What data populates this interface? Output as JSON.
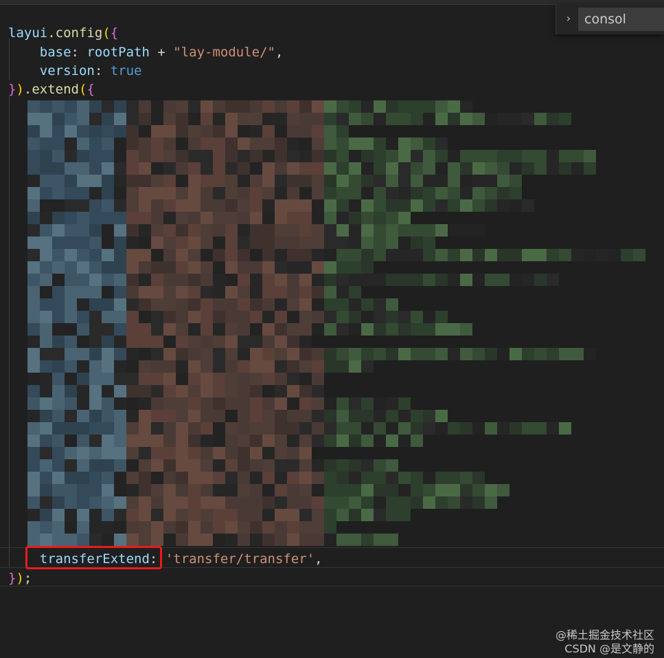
{
  "find_widget": {
    "toggle_icon": "chevron-right-icon",
    "query": "consol"
  },
  "code": {
    "line1": {
      "ident": "layui",
      "dot": ".",
      "fn": "config",
      "open": "(",
      "brace": "{"
    },
    "line2": {
      "key": "base",
      "colon": ": ",
      "value": "rootPath",
      "op": " + ",
      "str": "\"lay-module/\"",
      "comma": ","
    },
    "line3": {
      "key": "version",
      "colon": ": ",
      "value": "true"
    },
    "line4": {
      "brace": "}",
      "close": ")",
      "dot": ".",
      "fn": "extend",
      "open": "(",
      "brace2": "{"
    },
    "line_last_key": {
      "key": "transferExtend",
      "colon": ":",
      "str": "'transfer/transfer'",
      "comma": ","
    },
    "line_end": {
      "brace": "}",
      "close": ")",
      "semi": ";"
    }
  },
  "watermark": {
    "line1": "@稀土掘金技术社区",
    "line2": "CSDN @是文静的"
  },
  "colors": {
    "background": "#1f1f1f",
    "highlight": "#e81c1c"
  }
}
